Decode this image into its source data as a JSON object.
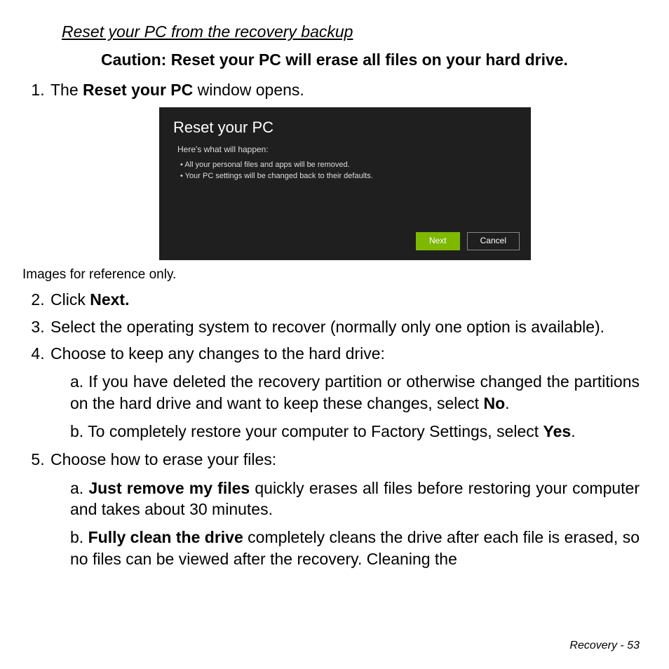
{
  "section_heading": "Reset your PC from the recovery backup",
  "caution": "Caution: Reset your PC will erase all files on your hard drive.",
  "step1_pre": "The ",
  "step1_bold": "Reset your PC",
  "step1_post": " window opens.",
  "shot": {
    "title": "Reset your PC",
    "intro": "Here's what will happen:",
    "bullets": [
      "All your personal files and apps will be removed.",
      "Your PC settings will be changed back to their defaults."
    ],
    "next": "Next",
    "cancel": "Cancel"
  },
  "ref_note": "Images for reference only.",
  "step2_pre": "Click ",
  "step2_bold": "Next.",
  "step3": "Select the operating system to recover (normally only one option is available).",
  "step4": "Choose to keep any changes to the hard drive:",
  "step4a_pre": "If you have deleted the recovery partition or otherwise changed the partitions on the hard drive and want to keep these changes, select ",
  "step4a_bold": "No",
  "step4a_post": ".",
  "step4b_pre": "To completely restore your computer to Factory Settings, select ",
  "step4b_bold": "Yes",
  "step4b_post": ".",
  "step5": "Choose how to erase your files:",
  "step5a_bold": "Just remove my files",
  "step5a_post": " quickly erases all files before restoring your computer and takes about 30 minutes.",
  "step5b_bold": "Fully clean the drive",
  "step5b_post": " completely cleans the drive after each file is erased, so no files can be viewed after the recovery. Cleaning the",
  "footer_label": "Recovery -  ",
  "footer_page": "53"
}
